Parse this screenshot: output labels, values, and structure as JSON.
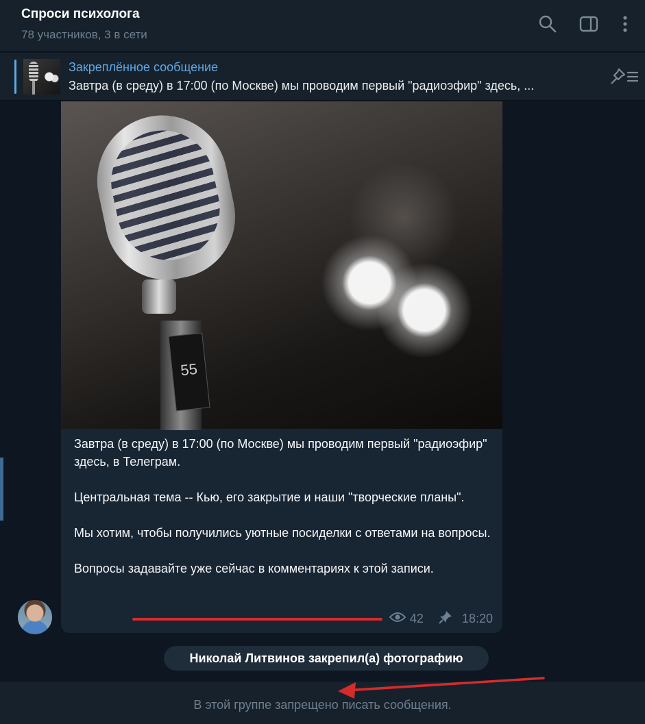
{
  "header": {
    "title": "Спроси психолога",
    "subtitle": "78 участников, 3 в сети"
  },
  "pinned": {
    "title": "Закреплённое сообщение",
    "text": "Завтра (в среду) в 17:00 (по Москве) мы проводим первый \"радиоэфир\" здесь, ..."
  },
  "message": {
    "paragraphs": [
      "Завтра (в среду) в 17:00 (по Москве) мы проводим первый \"радиоэфир\" здесь, в Телеграм.",
      "Центральная тема -- Кью, его закрытие и наши \"творческие планы\".",
      "Мы хотим, чтобы получились уютные посиделки с ответами на вопросы.",
      "Вопросы задавайте уже сейчас в комментариях к этой записи."
    ],
    "views": "42",
    "time": "18:20",
    "photo_label": "55"
  },
  "service_message": "Николай Литвинов закрепил(а) фотографию",
  "bottom": {
    "restriction": "В этой группе запрещено писать сообщения."
  },
  "icons": [
    "search-icon",
    "sidebar-toggle-icon",
    "more-vertical-icon",
    "unpin-icon",
    "eye-icon",
    "pin-icon"
  ],
  "colors": {
    "background": "#0e1621",
    "panel": "#17212b",
    "bubble": "#182533",
    "accent": "#5ea8e6",
    "annotation": "#d62b2b"
  }
}
